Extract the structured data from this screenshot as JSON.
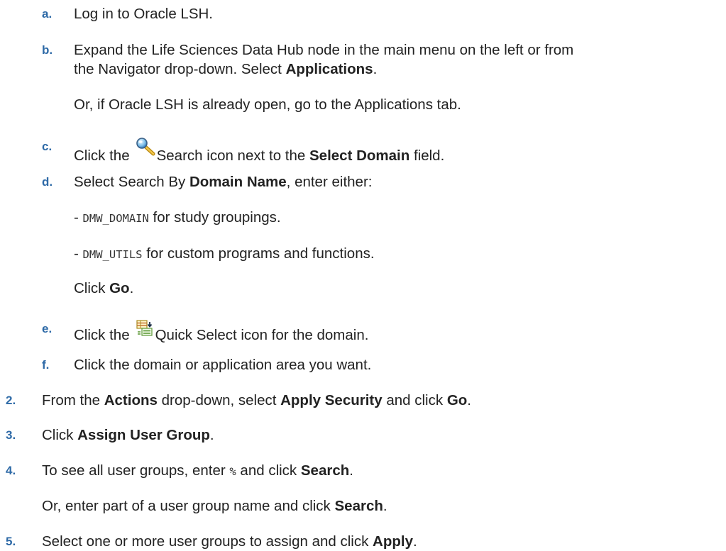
{
  "sub_steps": {
    "a": {
      "marker": "a.",
      "text": "Log in to Oracle LSH."
    },
    "b": {
      "marker": "b.",
      "line1": "Expand the Life Sciences Data Hub node in the main menu on the left or from",
      "line2_pre": "the Navigator drop-down. Select ",
      "line2_bold": "Applications",
      "line2_post": ".",
      "alt": "Or, if Oracle LSH is already open, go to the Applications tab."
    },
    "c": {
      "marker": "c.",
      "pre": "Click the",
      "icon": "search-magnifier-icon",
      "mid": "Search icon next to the ",
      "bold": "Select Domain",
      "post": " field."
    },
    "d": {
      "marker": "d.",
      "pre": "Select Search By ",
      "bold": "Domain Name",
      "post": ", enter either:",
      "opt1_dash": "- ",
      "opt1_code": "DMW_DOMAIN",
      "opt1_text": " for study groupings.",
      "opt2_dash": "- ",
      "opt2_code": "DMW_UTILS",
      "opt2_text": " for custom programs and functions.",
      "go_pre": "Click ",
      "go_bold": "Go",
      "go_post": "."
    },
    "e": {
      "marker": "e.",
      "pre": "Click the",
      "icon": "quick-select-icon",
      "post": "Quick Select icon for the domain."
    },
    "f": {
      "marker": "f.",
      "text": "Click the domain or application area you want."
    }
  },
  "steps": {
    "s2": {
      "marker": "2.",
      "pre": "From the ",
      "bold1": "Actions",
      "mid": " drop-down, select ",
      "bold2": "Apply Security",
      "mid2": " and click ",
      "bold3": "Go",
      "post": "."
    },
    "s3": {
      "marker": "3.",
      "pre": "Click ",
      "bold": "Assign User Group",
      "post": "."
    },
    "s4": {
      "marker": "4.",
      "pre": "To see all user groups, enter ",
      "code": "%",
      "mid": " and click ",
      "bold": "Search",
      "post": ".",
      "alt_pre": "Or, enter part of a user group name and click ",
      "alt_bold": "Search",
      "alt_post": "."
    },
    "s5": {
      "marker": "5.",
      "pre": "Select one or more user groups to assign and click ",
      "bold": "Apply",
      "post": "."
    }
  },
  "colors": {
    "marker": "#2e6aa7",
    "text": "#222222"
  }
}
